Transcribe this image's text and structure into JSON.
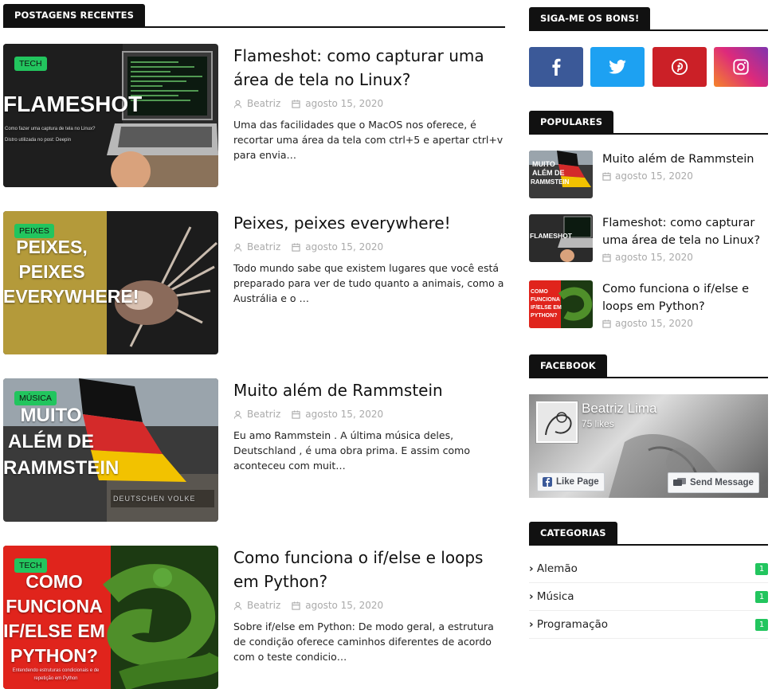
{
  "main": {
    "section_title": "POSTAGENS RECENTES",
    "posts": [
      {
        "category": "TECH",
        "thumb_title": "FLAMESHOT",
        "thumb_sub": "Como fazer uma captura de tela no Linux? Distro utilizada no post: Deepin",
        "title": "Flameshot: como capturar uma área de tela no Linux?",
        "author": "Beatriz",
        "date": "agosto 15, 2020",
        "excerpt": "Uma das facilidades que o MacOS nos oferece, é recortar uma área da tela com ctrl+5 e apertar ctrl+v para envia…"
      },
      {
        "category": "PEIXES",
        "thumb_title": "PEIXES, PEIXES EVERYWHERE!",
        "title": "Peixes, peixes everywhere!",
        "author": "Beatriz",
        "date": "agosto 15, 2020",
        "excerpt": "Todo mundo sabe que existem lugares que você está preparado para ver de tudo quanto a animais, como a Austrália e o …"
      },
      {
        "category": "MÚSICA",
        "thumb_title": "MUITO ALÉM DE RAMMSTEIN",
        "thumb_sign": "DEUTSCHEN VOLKE",
        "title": "Muito além de Rammstein",
        "author": "Beatriz",
        "date": "agosto 15, 2020",
        "excerpt": "Eu amo Rammstein . A última música deles, Deutschland , é uma obra prima. E assim como aconteceu com muit…"
      },
      {
        "category": "TECH",
        "thumb_title": "COMO FUNCIONA IF/ELSE EM PYTHON?",
        "thumb_sub": "Entendendo estruturas condicionais e de repetição em Python",
        "title": "Como funciona o if/else e loops em Python?",
        "author": "Beatriz",
        "date": "agosto 15, 2020",
        "excerpt": "Sobre if/else em Python: De modo geral, a estrutura de condição oferece caminhos diferentes de acordo com o teste condicio…"
      }
    ]
  },
  "sidebar": {
    "follow_title": "SIGA-ME OS BONS!",
    "social": [
      {
        "name": "facebook",
        "color": "#3b5998"
      },
      {
        "name": "twitter",
        "color": "#1da1f2"
      },
      {
        "name": "pinterest",
        "color": "#cb2027"
      },
      {
        "name": "instagram",
        "color": "#c13584"
      }
    ],
    "popular_title": "POPULARES",
    "popular": [
      {
        "title": "Muito além de Rammstein",
        "date": "agosto 15, 2020"
      },
      {
        "title": "Flameshot: como capturar uma área de tela no Linux?",
        "date": "agosto 15, 2020"
      },
      {
        "title": "Como funciona o if/else e loops em Python?",
        "date": "agosto 15, 2020"
      }
    ],
    "facebook_title": "FACEBOOK",
    "facebook": {
      "page_name": "Beatriz Lima",
      "likes": "75 likes",
      "like_button": "Like Page",
      "message_button": "Send Message"
    },
    "categories_title": "CATEGORIAS",
    "categories": [
      {
        "label": "Alemão",
        "count": "1"
      },
      {
        "label": "Música",
        "count": "1"
      },
      {
        "label": "Programação",
        "count": "1"
      }
    ]
  },
  "colors": {
    "accent": "#22c55e",
    "heading_bg": "#111111"
  }
}
